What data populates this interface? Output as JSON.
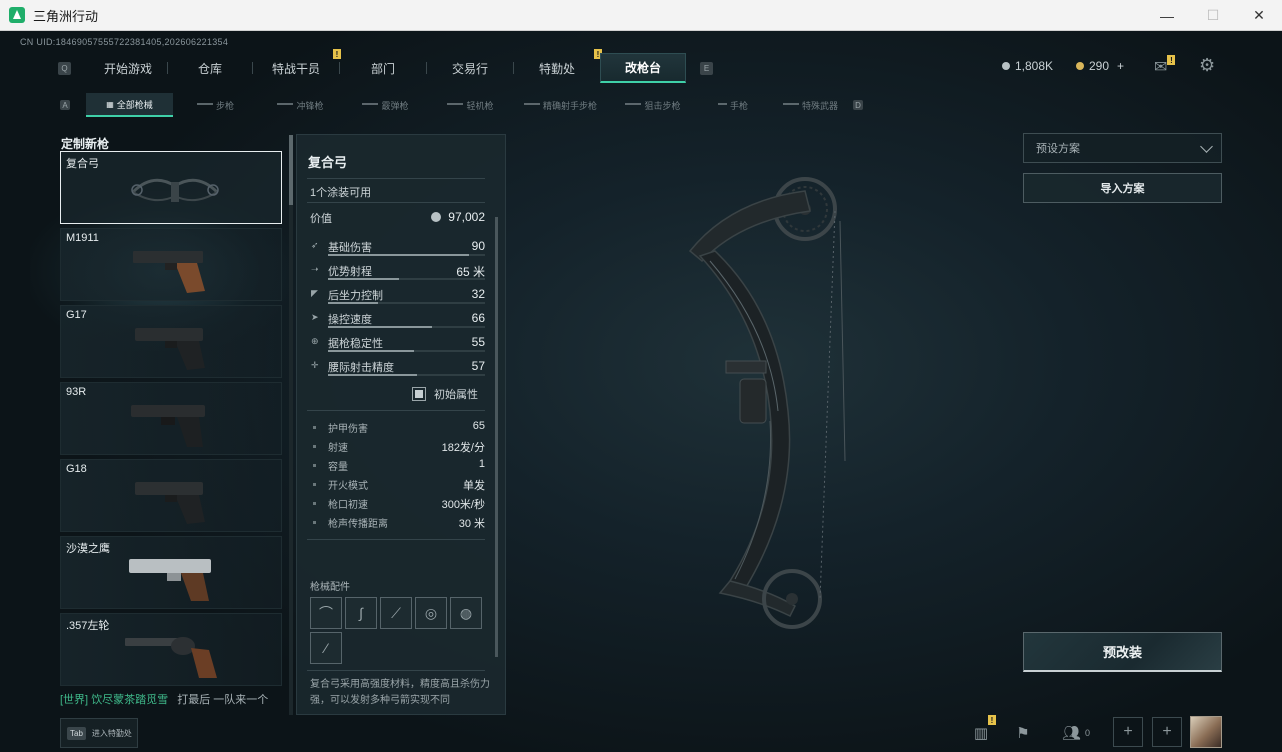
{
  "window": {
    "title": "三角洲行动",
    "min": "—",
    "max": "☐",
    "close": "✕"
  },
  "uid": "CN UID:18469057555722381405,202606221354",
  "nav": {
    "key_left": "Q",
    "key_right": "E",
    "tabs": [
      {
        "label": "开始游戏",
        "badge": ""
      },
      {
        "label": "仓库",
        "badge": ""
      },
      {
        "label": "特战干员",
        "badge": "!"
      },
      {
        "label": "部门",
        "badge": ""
      },
      {
        "label": "交易行",
        "badge": ""
      },
      {
        "label": "特勤处",
        "badge": "!"
      },
      {
        "label": "改枪台",
        "badge": "",
        "active": true
      }
    ]
  },
  "currency": {
    "silver": "1,808K",
    "gold": "290",
    "plus": "+",
    "mail_badge": "!"
  },
  "subnav": {
    "key_left": "A",
    "key_right": "D",
    "tabs": [
      {
        "label": "全部枪械",
        "active": true
      },
      {
        "label": "步枪"
      },
      {
        "label": "冲锋枪"
      },
      {
        "label": "霰弹枪"
      },
      {
        "label": "轻机枪"
      },
      {
        "label": "精确射手步枪"
      },
      {
        "label": "狙击步枪"
      },
      {
        "label": "手枪"
      },
      {
        "label": "特殊武器"
      }
    ]
  },
  "gun_list": {
    "title": "定制新枪",
    "items": [
      {
        "name": "复合弓",
        "selected": true
      },
      {
        "name": "M1911"
      },
      {
        "name": "G17"
      },
      {
        "name": "93R"
      },
      {
        "name": "G18"
      },
      {
        "name": "沙漠之鹰"
      },
      {
        "name": ".357左轮"
      }
    ]
  },
  "detail": {
    "title": "复合弓",
    "skins": "1个涂装可用",
    "value_label": "价值",
    "value": "97,002",
    "stats": [
      {
        "label": "基础伤害",
        "value": "90",
        "fill": 0.9,
        "icon": "damage-icon"
      },
      {
        "label": "优势射程",
        "value": "65 米",
        "fill": 0.45,
        "icon": "range-icon"
      },
      {
        "label": "后坐力控制",
        "value": "32",
        "fill": 0.32,
        "icon": "recoil-icon"
      },
      {
        "label": "操控速度",
        "value": "66",
        "fill": 0.66,
        "icon": "handling-icon"
      },
      {
        "label": "据枪稳定性",
        "value": "55",
        "fill": 0.55,
        "icon": "stability-icon"
      },
      {
        "label": "腰际射击精度",
        "value": "57",
        "fill": 0.57,
        "icon": "hipfire-icon"
      }
    ],
    "initial_attr": "初始属性",
    "attributes": [
      {
        "label": "护甲伤害",
        "value": "65"
      },
      {
        "label": "射速",
        "value": "182发/分"
      },
      {
        "label": "容量",
        "value": "1"
      },
      {
        "label": "开火模式",
        "value": "单发"
      },
      {
        "label": "枪口初速",
        "value": "300米/秒"
      },
      {
        "label": "枪声传播距离",
        "value": "30 米"
      }
    ],
    "parts_title": "枪械配件",
    "description": "复合弓采用高强度材料，精度高且杀伤力强，可以发射多种弓箭实现不同"
  },
  "right_panel": {
    "preset_placeholder": "预设方案",
    "import_label": "导入方案",
    "premod_label": "预改装"
  },
  "chat": {
    "channel": "[世界]",
    "user": "饮尽蒙茶踏觅雪",
    "message": "打最后 一队来一个"
  },
  "bottom": {
    "tab_key": "Tab",
    "tab_label": "进入特勤处",
    "friends_count": "0",
    "stats_badge": "!"
  },
  "colors": {
    "accent": "#3fd0a8",
    "badge": "#e6c24a",
    "chat_green": "#3fb98a"
  }
}
